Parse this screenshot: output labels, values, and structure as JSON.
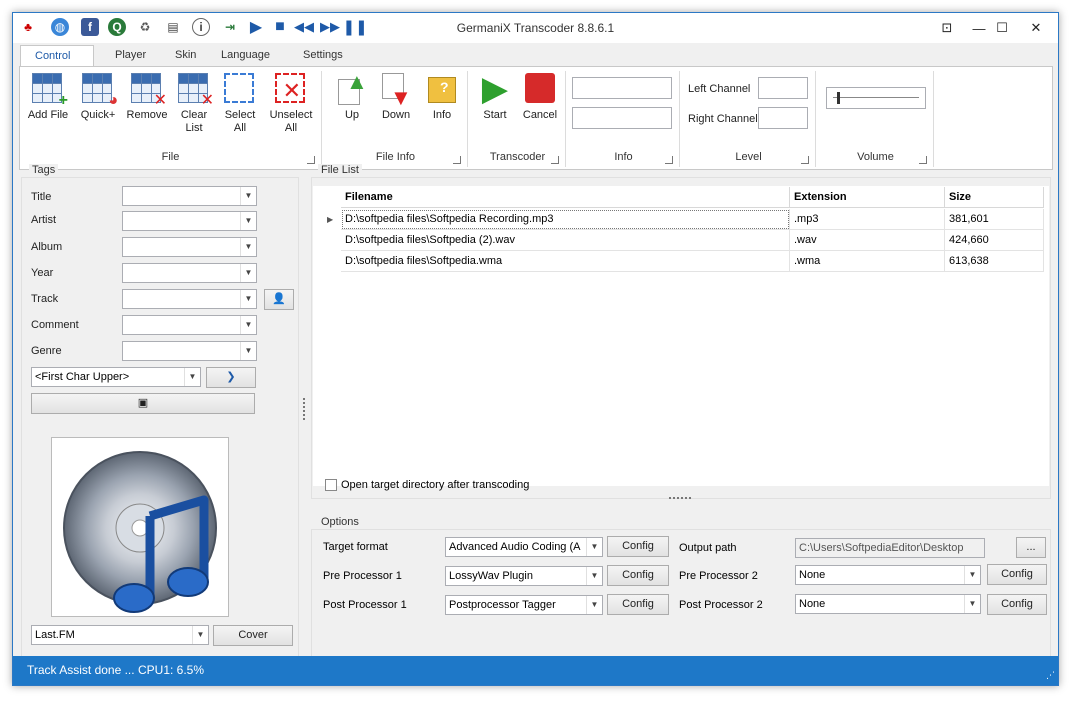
{
  "window": {
    "title": "GermaniX Transcoder 8.8.6.1"
  },
  "quick_access": [
    {
      "icon": "mp3-tag-icon"
    },
    {
      "icon": "globe-icon"
    },
    {
      "icon": "facebook-icon"
    },
    {
      "icon": "search-web-icon"
    },
    {
      "icon": "recycle-icon"
    },
    {
      "icon": "clipboard-icon"
    },
    {
      "icon": "info-icon"
    },
    {
      "icon": "export-icon"
    },
    {
      "icon": "play-icon"
    },
    {
      "icon": "stop-icon"
    },
    {
      "icon": "previous-icon"
    },
    {
      "icon": "next-icon"
    },
    {
      "icon": "pause-icon"
    }
  ],
  "tabs": [
    "Control",
    "Player",
    "Skin",
    "Language",
    "Settings"
  ],
  "ribbon": {
    "file_group": {
      "label": "File",
      "buttons": [
        {
          "line1": "Add File",
          "line2": ""
        },
        {
          "line1": "Quick+",
          "line2": ""
        },
        {
          "line1": "Remove",
          "line2": ""
        },
        {
          "line1": "Clear",
          "line2": "List"
        },
        {
          "line1": "Select",
          "line2": "All"
        },
        {
          "line1": "Unselect",
          "line2": "All"
        }
      ]
    },
    "fileinfo_group": {
      "label": "File Info",
      "buttons": [
        {
          "line1": "Up"
        },
        {
          "line1": "Down"
        },
        {
          "line1": "Info"
        }
      ]
    },
    "transcoder_group": {
      "label": "Transcoder",
      "buttons": [
        {
          "line1": "Start"
        },
        {
          "line1": "Cancel"
        }
      ]
    },
    "info_group": {
      "label": "Info"
    },
    "level_group": {
      "label": "Level",
      "left": "Left Channel",
      "right": "Right Channel"
    },
    "volume_group": {
      "label": "Volume",
      "level": 0.05
    }
  },
  "tags": {
    "title": "Tags",
    "fields": [
      "Title",
      "Artist",
      "Album",
      "Year",
      "Track",
      "Comment",
      "Genre"
    ],
    "case_option": "<First Char Upper>",
    "cover_source": "Last.FM",
    "cover_button": "Cover"
  },
  "file_list": {
    "title": "File List",
    "columns": [
      "Filename",
      "Extension",
      "Size"
    ],
    "rows": [
      {
        "filename": "D:\\softpedia files\\Softpedia Recording.mp3",
        "ext": ".mp3",
        "size": "381,601"
      },
      {
        "filename": "D:\\softpedia files\\Softpedia (2).wav",
        "ext": ".wav",
        "size": "424,660"
      },
      {
        "filename": "D:\\softpedia files\\Softpedia.wma",
        "ext": ".wma",
        "size": "613,638"
      }
    ],
    "open_target_label": "Open target directory after transcoding"
  },
  "options": {
    "title": "Options",
    "target_format_label": "Target format",
    "target_format_value": "Advanced Audio Coding (A",
    "pre1_label": "Pre Processor 1",
    "pre1_value": "LossyWav Plugin",
    "post1_label": "Post Processor 1",
    "post1_value": "Postprocessor Tagger",
    "output_label": "Output path",
    "output_value": "C:\\Users\\SoftpediaEditor\\Desktop",
    "browse": "...",
    "pre2_label": "Pre Processor 2",
    "pre2_value": "None",
    "post2_label": "Post Processor 2",
    "post2_value": "None",
    "config": "Config"
  },
  "status": {
    "message": "Track Assist done ...",
    "cpu": "CPU1: 6.5%"
  }
}
